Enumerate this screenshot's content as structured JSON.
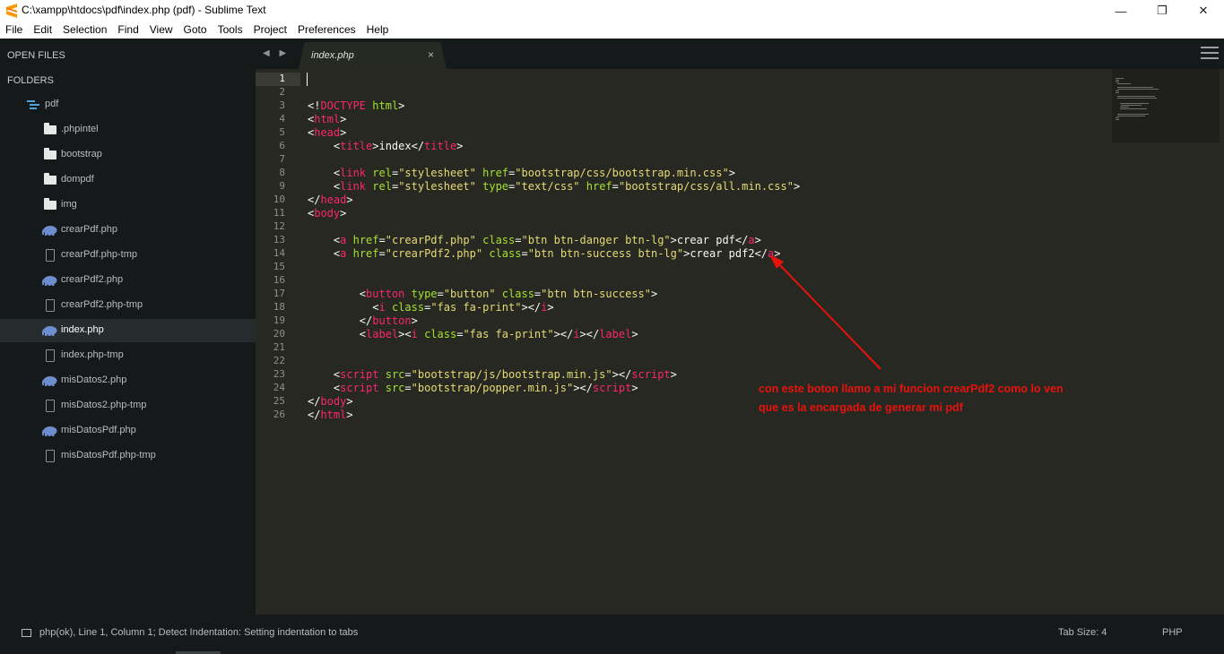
{
  "window": {
    "title": "C:\\xampp\\htdocs\\pdf\\index.php (pdf) - Sublime Text",
    "minimize": "—",
    "maximize": "❐",
    "close": "✕"
  },
  "menu": [
    "File",
    "Edit",
    "Selection",
    "Find",
    "View",
    "Goto",
    "Tools",
    "Project",
    "Preferences",
    "Help"
  ],
  "sidebar": {
    "open_files_label": "OPEN FILES",
    "folders_label": "FOLDERS",
    "root_folder": "pdf",
    "items": [
      {
        "label": ".phpintel",
        "icon": "folder-icon"
      },
      {
        "label": "bootstrap",
        "icon": "folder-icon"
      },
      {
        "label": "dompdf",
        "icon": "folder-icon"
      },
      {
        "label": "img",
        "icon": "folder-icon"
      },
      {
        "label": "crearPdf.php",
        "icon": "php-elephant-icon"
      },
      {
        "label": "crearPdf.php-tmp",
        "icon": "file-icon"
      },
      {
        "label": "crearPdf2.php",
        "icon": "php-elephant-icon"
      },
      {
        "label": "crearPdf2.php-tmp",
        "icon": "file-icon"
      },
      {
        "label": "index.php",
        "icon": "php-elephant-icon",
        "selected": true
      },
      {
        "label": "index.php-tmp",
        "icon": "file-icon"
      },
      {
        "label": "misDatos2.php",
        "icon": "php-elephant-icon"
      },
      {
        "label": "misDatos2.php-tmp",
        "icon": "file-icon"
      },
      {
        "label": "misDatosPdf.php",
        "icon": "php-elephant-icon"
      },
      {
        "label": "misDatosPdf.php-tmp",
        "icon": "file-icon"
      }
    ]
  },
  "tabs": {
    "nav_arrows": "◀ ▶",
    "active_tab": "index.php",
    "close_glyph": "×"
  },
  "editor": {
    "active_line": 1,
    "line_numbers": [
      "1",
      "2",
      "3",
      "4",
      "5",
      "6",
      "7",
      "8",
      "9",
      "10",
      "11",
      "12",
      "13",
      "14",
      "15",
      "16",
      "17",
      "18",
      "19",
      "20",
      "21",
      "22",
      "23",
      "24",
      "25",
      "26"
    ],
    "lines": [
      [],
      [],
      [
        [
          "punc",
          "<!"
        ],
        [
          "tag",
          "DOCTYPE"
        ],
        [
          "punc",
          " "
        ],
        [
          "attr",
          "html"
        ],
        [
          "punc",
          ">"
        ]
      ],
      [
        [
          "punc",
          "<"
        ],
        [
          "tag",
          "html"
        ],
        [
          "punc",
          ">"
        ]
      ],
      [
        [
          "punc",
          "<"
        ],
        [
          "tag",
          "head"
        ],
        [
          "punc",
          ">"
        ]
      ],
      [
        [
          "punc",
          "    <"
        ],
        [
          "tag",
          "title"
        ],
        [
          "punc",
          ">index</"
        ],
        [
          "tag",
          "title"
        ],
        [
          "punc",
          ">"
        ]
      ],
      [],
      [
        [
          "punc",
          "    <"
        ],
        [
          "tag",
          "link"
        ],
        [
          "punc",
          " "
        ],
        [
          "attr",
          "rel"
        ],
        [
          "punc",
          "="
        ],
        [
          "str",
          "\"stylesheet\""
        ],
        [
          "punc",
          " "
        ],
        [
          "attr",
          "href"
        ],
        [
          "punc",
          "="
        ],
        [
          "str",
          "\"bootstrap/css/bootstrap.min.css\""
        ],
        [
          "punc",
          ">"
        ]
      ],
      [
        [
          "punc",
          "    <"
        ],
        [
          "tag",
          "link"
        ],
        [
          "punc",
          " "
        ],
        [
          "attr",
          "rel"
        ],
        [
          "punc",
          "="
        ],
        [
          "str",
          "\"stylesheet\""
        ],
        [
          "punc",
          " "
        ],
        [
          "attr",
          "type"
        ],
        [
          "punc",
          "="
        ],
        [
          "str",
          "\"text/css\""
        ],
        [
          "punc",
          " "
        ],
        [
          "attr",
          "href"
        ],
        [
          "punc",
          "="
        ],
        [
          "str",
          "\"bootstrap/css/all.min.css\""
        ],
        [
          "punc",
          ">"
        ]
      ],
      [
        [
          "punc",
          "</"
        ],
        [
          "tag",
          "head"
        ],
        [
          "punc",
          ">"
        ]
      ],
      [
        [
          "punc",
          "<"
        ],
        [
          "tag",
          "body"
        ],
        [
          "punc",
          ">"
        ]
      ],
      [],
      [
        [
          "punc",
          "    <"
        ],
        [
          "tag",
          "a"
        ],
        [
          "punc",
          " "
        ],
        [
          "attr",
          "href"
        ],
        [
          "punc",
          "="
        ],
        [
          "str",
          "\"crearPdf.php\""
        ],
        [
          "punc",
          " "
        ],
        [
          "attr",
          "class"
        ],
        [
          "punc",
          "="
        ],
        [
          "str",
          "\"btn btn-danger btn-lg\""
        ],
        [
          "punc",
          ">crear pdf</"
        ],
        [
          "tag",
          "a"
        ],
        [
          "punc",
          ">"
        ]
      ],
      [
        [
          "punc",
          "    <"
        ],
        [
          "tag",
          "a"
        ],
        [
          "punc",
          " "
        ],
        [
          "attr",
          "href"
        ],
        [
          "punc",
          "="
        ],
        [
          "str",
          "\"crearPdf2.php\""
        ],
        [
          "punc",
          " "
        ],
        [
          "attr",
          "class"
        ],
        [
          "punc",
          "="
        ],
        [
          "str",
          "\"btn btn-success btn-lg\""
        ],
        [
          "punc",
          ">crear pdf2</"
        ],
        [
          "tag",
          "a"
        ],
        [
          "punc",
          ">"
        ]
      ],
      [],
      [],
      [
        [
          "punc",
          "        <"
        ],
        [
          "tag",
          "button"
        ],
        [
          "punc",
          " "
        ],
        [
          "attr",
          "type"
        ],
        [
          "punc",
          "="
        ],
        [
          "str",
          "\"button\""
        ],
        [
          "punc",
          " "
        ],
        [
          "attr",
          "class"
        ],
        [
          "punc",
          "="
        ],
        [
          "str",
          "\"btn btn-success\""
        ],
        [
          "punc",
          ">"
        ]
      ],
      [
        [
          "punc",
          "          <"
        ],
        [
          "tag",
          "i"
        ],
        [
          "punc",
          " "
        ],
        [
          "attr",
          "class"
        ],
        [
          "punc",
          "="
        ],
        [
          "str",
          "\"fas fa-print\""
        ],
        [
          "punc",
          "></"
        ],
        [
          "tag",
          "i"
        ],
        [
          "punc",
          ">"
        ]
      ],
      [
        [
          "punc",
          "        </"
        ],
        [
          "tag",
          "button"
        ],
        [
          "punc",
          ">"
        ]
      ],
      [
        [
          "punc",
          "        <"
        ],
        [
          "tag",
          "label"
        ],
        [
          "punc",
          "><"
        ],
        [
          "tag",
          "i"
        ],
        [
          "punc",
          " "
        ],
        [
          "attr",
          "class"
        ],
        [
          "punc",
          "="
        ],
        [
          "str",
          "\"fas fa-print\""
        ],
        [
          "punc",
          "></"
        ],
        [
          "tag",
          "i"
        ],
        [
          "punc",
          "></"
        ],
        [
          "tag",
          "label"
        ],
        [
          "punc",
          ">"
        ]
      ],
      [],
      [],
      [
        [
          "punc",
          "    <"
        ],
        [
          "tag",
          "script"
        ],
        [
          "punc",
          " "
        ],
        [
          "attr",
          "src"
        ],
        [
          "punc",
          "="
        ],
        [
          "str",
          "\"bootstrap/js/bootstrap.min.js\""
        ],
        [
          "punc",
          "></"
        ],
        [
          "tag",
          "script"
        ],
        [
          "punc",
          ">"
        ]
      ],
      [
        [
          "punc",
          "    <"
        ],
        [
          "tag",
          "script"
        ],
        [
          "punc",
          " "
        ],
        [
          "attr",
          "src"
        ],
        [
          "punc",
          "="
        ],
        [
          "str",
          "\"bootstrap/popper.min.js\""
        ],
        [
          "punc",
          "></"
        ],
        [
          "tag",
          "script"
        ],
        [
          "punc",
          ">"
        ]
      ],
      [
        [
          "punc",
          "</"
        ],
        [
          "tag",
          "body"
        ],
        [
          "punc",
          ">"
        ]
      ],
      [
        [
          "punc",
          "</"
        ],
        [
          "tag",
          "html"
        ],
        [
          "punc",
          ">"
        ]
      ]
    ]
  },
  "annotation": {
    "line1": "con este boton llamo a mi funcion crearPdf2 como lo ven",
    "line2": "que es la encargada de generar mi pdf",
    "color": "#e8120c"
  },
  "status": {
    "message": "php(ok), Line 1, Column 1; Detect Indentation: Setting indentation to tabs",
    "tab_size": "Tab Size: 4",
    "syntax": "PHP"
  },
  "colors": {
    "sidebar_bg": "#15191a",
    "editor_bg": "#272822",
    "tag": "#f92672",
    "attr": "#a6e22e",
    "string": "#e6db74"
  }
}
